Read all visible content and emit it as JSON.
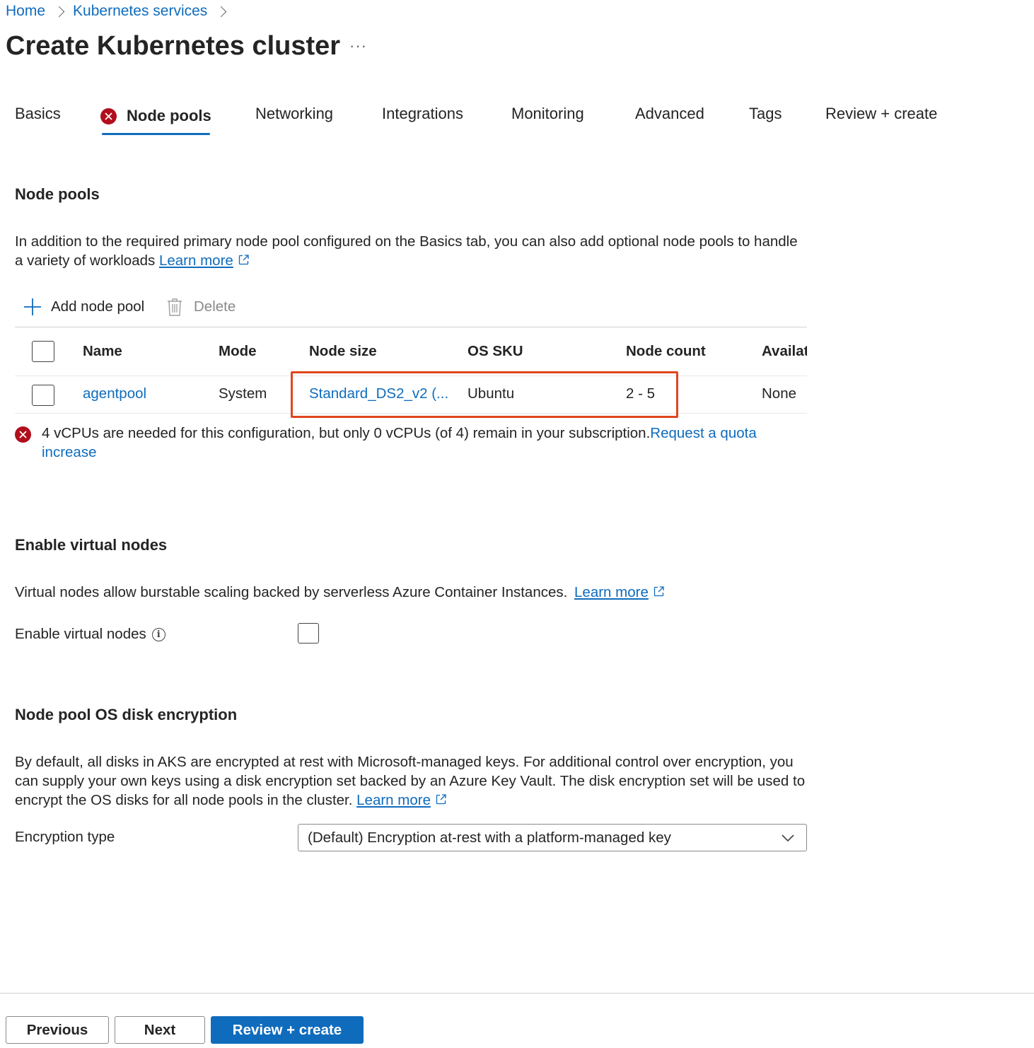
{
  "breadcrumb": {
    "home": "Home",
    "services": "Kubernetes services"
  },
  "page": {
    "title": "Create Kubernetes cluster",
    "more": "···"
  },
  "tabs": [
    {
      "label": "Basics"
    },
    {
      "label": "Node pools",
      "active": true,
      "has_error": true
    },
    {
      "label": "Networking"
    },
    {
      "label": "Integrations"
    },
    {
      "label": "Monitoring"
    },
    {
      "label": "Advanced"
    },
    {
      "label": "Tags"
    },
    {
      "label": "Review + create"
    }
  ],
  "node_pools": {
    "title": "Node pools",
    "description": "In addition to the required primary node pool configured on the Basics tab, you can also add optional node pools to handle a variety of workloads",
    "learn_more": "Learn more",
    "add_label": "Add node pool",
    "delete_label": "Delete",
    "table": {
      "columns": [
        "Name",
        "Mode",
        "Node size",
        "OS SKU",
        "Node count",
        "Availat"
      ],
      "rows": [
        {
          "name": "agentpool",
          "mode": "System",
          "node_size": "Standard_DS2_v2 (...",
          "os_sku": "Ubuntu",
          "node_count": "2 - 5",
          "availability": "None"
        }
      ]
    },
    "error": {
      "text": "4 vCPUs are needed for this configuration, but only 0 vCPUs (of 4) remain in your subscription.",
      "link": "Request a quota increase"
    }
  },
  "virtual_nodes": {
    "title": "Enable virtual nodes",
    "description": "Virtual nodes allow burstable scaling backed by serverless Azure Container Instances.",
    "learn_more": "Learn more",
    "field_label": "Enable virtual nodes",
    "checked": false
  },
  "encryption": {
    "title": "Node pool OS disk encryption",
    "description": "By default, all disks in AKS are encrypted at rest with Microsoft-managed keys. For additional control over encryption, you can supply your own keys using a disk encryption set backed by an Azure Key Vault. The disk encryption set will be used to encrypt the OS disks for all node pools in the cluster.",
    "learn_more": "Learn more",
    "field_label": "Encryption type",
    "selected": "(Default) Encryption at-rest with a platform-managed key"
  },
  "footer": {
    "previous": "Previous",
    "next": "Next",
    "review": "Review + create"
  },
  "colors": {
    "accent": "#0f6cbd",
    "error": "#b10e1c",
    "highlight": "#e0461e"
  },
  "icons": [
    "chevron-right-icon",
    "error-icon",
    "add-icon",
    "trash-icon",
    "external-link-icon",
    "info-icon",
    "chevron-down-icon"
  ]
}
